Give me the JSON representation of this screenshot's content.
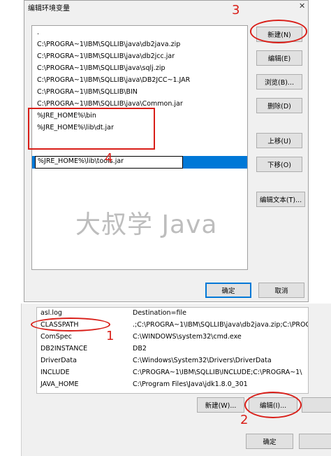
{
  "dialog": {
    "title": "编辑环境变量",
    "close": "✕",
    "paths": [
      ".",
      "C:\\PROGRA~1\\IBM\\SQLLIB\\java\\db2java.zip",
      "C:\\PROGRA~1\\IBM\\SQLLIB\\java\\db2jcc.jar",
      "C:\\PROGRA~1\\IBM\\SQLLIB\\java\\sqlj.zip",
      "C:\\PROGRA~1\\IBM\\SQLLIB\\java\\DB2JCC~1.JAR",
      "C:\\PROGRA~1\\IBM\\SQLLIB\\BIN",
      "C:\\PROGRA~1\\IBM\\SQLLIB\\java\\Common.jar",
      "%JRE_HOME%\\bin",
      "%JRE_HOME%\\lib\\dt.jar"
    ],
    "editing_value": "%JRE_HOME%\\lib\\tools.jar",
    "buttons": {
      "new": "新建(N)",
      "edit": "编辑(E)",
      "browse": "浏览(B)...",
      "delete": "删除(D)",
      "move_up": "上移(U)",
      "move_down": "下移(O)",
      "edit_text": "编辑文本(T)...",
      "ok": "确定",
      "cancel": "取消"
    },
    "watermark": "大叔学 Java"
  },
  "env_window": {
    "rows": [
      {
        "name": "asl.log",
        "value": "Destination=file"
      },
      {
        "name": "CLASSPATH",
        "value": ".;C:\\PROGRA~1\\IBM\\SQLLIB\\java\\db2java.zip;C:\\PROG"
      },
      {
        "name": "ComSpec",
        "value": "C:\\WINDOWS\\system32\\cmd.exe"
      },
      {
        "name": "DB2INSTANCE",
        "value": "DB2"
      },
      {
        "name": "DriverData",
        "value": "C:\\Windows\\System32\\Drivers\\DriverData"
      },
      {
        "name": "INCLUDE",
        "value": "C:\\PROGRA~1\\IBM\\SQLLIB\\INCLUDE;C:\\PROGRA~1\\"
      },
      {
        "name": "JAVA_HOME",
        "value": "C:\\Program Files\\Java\\jdk1.8.0_301"
      }
    ],
    "buttons": {
      "new": "新建(W)...",
      "edit": "编辑(I)...",
      "ok": "确定"
    }
  },
  "annotations": {
    "n1": "1",
    "n2": "2",
    "n3": "3",
    "n4": "4"
  },
  "colors": {
    "annotation": "#d91e18",
    "selection": "#0078d7"
  }
}
